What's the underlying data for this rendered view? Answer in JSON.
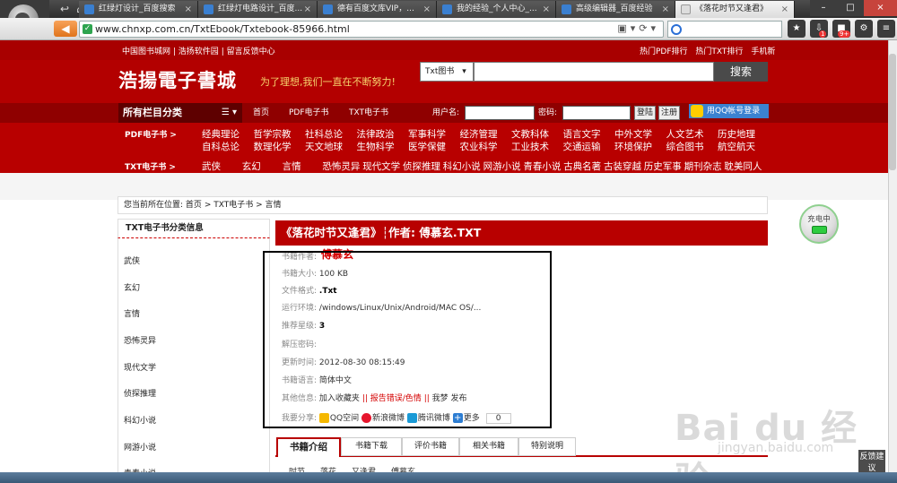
{
  "browser": {
    "tabs": [
      {
        "label": "红绿灯设计_百度搜索"
      },
      {
        "label": "红绿灯电路设计_百度..."
      },
      {
        "label": "德有百度文库VIP，..."
      },
      {
        "label": "我的经验_个人中心_..."
      },
      {
        "label": "高级编辑器_百度经验"
      },
      {
        "label": "《落花时节又逢君》"
      }
    ],
    "url": "www.chnxp.com.cn/TxtEbook/Txtebook-85966.html",
    "badges": {
      "downloads": "1",
      "games": "9+"
    }
  },
  "site": {
    "top_links": [
      "中国图书城网",
      "浩扬软件园",
      "留言反馈中心"
    ],
    "top_right_links": [
      "热门PDF排行",
      "热门TXT排行",
      "手机新"
    ],
    "title": "浩揚電子書城",
    "slogan": "为了理想,我们一直在不断努力!",
    "search_select": "Txt图书",
    "search_button": "搜索",
    "nav": {
      "all_categories": "所有栏目分类",
      "links": [
        "首页",
        "PDF电子书",
        "TXT电子书"
      ],
      "username_label": "用户名:",
      "password_label": "密码:",
      "login_button": "登陆",
      "register_button": "注册",
      "qq_login": "用QQ帐号登录"
    },
    "pdf_header": "PDF电子书 >",
    "pdf_row1": [
      "经典理论",
      "哲学宗教",
      "社科总论",
      "法律政治",
      "军事科学",
      "经济管理",
      "文教科体",
      "语言文字",
      "中外文学",
      "人文艺术",
      "历史地理"
    ],
    "pdf_row2": [
      "自科总论",
      "数理化学",
      "天文地球",
      "生物科学",
      "医学保健",
      "农业科学",
      "工业技术",
      "交通运输",
      "环境保护",
      "综合图书",
      "航空航天"
    ],
    "txt_header": "TXT电子书 >",
    "txt_row": [
      "武侠",
      "玄幻",
      "言情",
      "恐怖灵异",
      "现代文学",
      "侦探推理",
      "科幻小说",
      "网游小说",
      "青春小说",
      "古典名著",
      "古装穿越",
      "历史军事",
      "期刊杂志",
      "耽美同人"
    ]
  },
  "breadcrumb": {
    "prefix": "您当前所在位置:",
    "parts": [
      "首页",
      ">",
      "TXT电子书",
      ">",
      "言情"
    ]
  },
  "sidebar": {
    "header": "TXT电子书分类信息",
    "items": [
      "武侠",
      "玄幻",
      "言情",
      "恐怖灵异",
      "现代文学",
      "侦探推理",
      "科幻小说",
      "网游小说",
      "青春小说"
    ]
  },
  "book": {
    "header": "《落花时节又逢君》┆作者: 傅慕玄.TXT",
    "author_label": "书籍作者:",
    "author": "傅慕玄",
    "size_label": "书籍大小:",
    "size": "100 KB",
    "format_label": "文件格式:",
    "format": ".Txt",
    "env_label": "运行环境:",
    "env": "/windows/Linux/Unix/Android/MAC OS/...",
    "rating_label": "推荐星级:",
    "rating": "3",
    "password_label": "解压密码:",
    "password": "",
    "updated_label": "更新时间:",
    "updated": "2012-08-30 08:15:49",
    "lang_label": "书籍语言:",
    "lang": "简体中文",
    "other_label": "其他信息:",
    "other_fav": "加入收藏夹",
    "other_sep": "||",
    "other_report": "报告错误/色情",
    "other_sep2": "||",
    "other_post": "我梦 发布",
    "share_label": "我要分享:",
    "share": [
      "QQ空间",
      "新浪微博",
      "腾讯微博",
      "更多"
    ],
    "share_count": "0"
  },
  "book_tabs": [
    "书籍介绍",
    "书籍下载",
    "评价书籍",
    "相关书籍",
    "特别说明"
  ],
  "tags": [
    "时节",
    "落花",
    "又逢君",
    "傅慕玄"
  ],
  "overlay": {
    "charging": "充电中",
    "watermark": "Bai du 经验",
    "watermark_sub": "jingyan.baidu.com",
    "feedback": "反馈建议"
  },
  "colors": {
    "brand_red": "#b80000",
    "dark_red": "#8f0000"
  }
}
